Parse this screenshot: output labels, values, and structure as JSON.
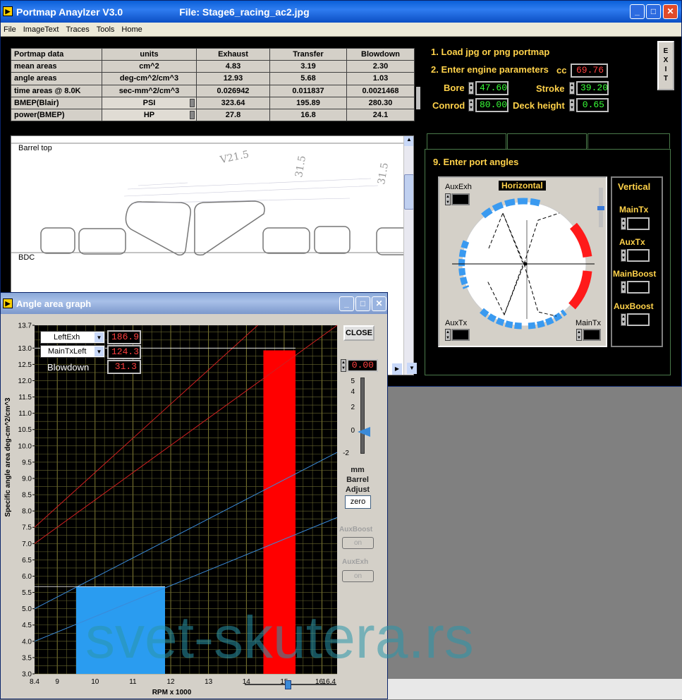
{
  "main_window": {
    "title": "Portmap Anaylzer V3.0",
    "file_label": "File: Stage6_racing_ac2.jpg"
  },
  "menu": [
    "File",
    "ImageText",
    "Traces",
    "Tools",
    "Home"
  ],
  "table": {
    "headers": [
      "Portmap data",
      "units",
      "Exhaust",
      "Transfer",
      "Blowdown"
    ],
    "rows": [
      [
        "mean areas",
        "cm^2",
        "4.83",
        "3.19",
        "2.30"
      ],
      [
        "angle areas",
        "deg-cm^2/cm^3",
        "12.93",
        "5.68",
        "1.03"
      ],
      [
        "time areas @ 8.0K",
        "sec-mm^2/cm^3",
        "0.026942",
        "0.011837",
        "0.0021468"
      ],
      [
        "BMEP(Blair)",
        "PSI",
        "323.64",
        "195.89",
        "280.30"
      ],
      [
        "power(BMEP)",
        "HP",
        "27.8",
        "16.8",
        "24.1"
      ]
    ]
  },
  "steps": {
    "load": "1. Load jpg or png portmap",
    "engine": "2. Enter engine parameters",
    "ports": "9. Enter port angles"
  },
  "engine": {
    "cc_label": "cc",
    "cc": "69.76",
    "bore_label": "Bore",
    "bore": "47.60",
    "stroke_label": "Stroke",
    "stroke": "39.20",
    "conrod_label": "Conrod",
    "conrod": "80.00",
    "deck_label": "Deck height",
    "deck": "0.65"
  },
  "exit_label": "EXIT",
  "image_view": {
    "top_label": "Barrel top",
    "bdc_label": "BDC",
    "handwriting": [
      "V21.5",
      "31.5",
      "31.5"
    ]
  },
  "port_panel": {
    "horizontal_label": "Horizontal",
    "vertical_label": "Vertical",
    "aux_exh": "AuxExh",
    "aux_tx": "AuxTx",
    "main_tx": "MainTx",
    "vertical_items": [
      "MainTx",
      "AuxTx",
      "MainBoost",
      "AuxBoost"
    ]
  },
  "angle_graph": {
    "title": "Angle area graph",
    "close_label": "CLOSE",
    "selectors": [
      {
        "label": "LeftExh",
        "value": "186.9"
      },
      {
        "label": "MainTxLeft",
        "value": "124.3"
      }
    ],
    "blowdown_label": "Blowdown",
    "blowdown_value": "31.3",
    "barrel_value": "0.00",
    "slider_ticks": [
      "5",
      "4",
      "2",
      "0",
      "-2"
    ],
    "barrel_caption": [
      "mm",
      "Barrel",
      "Adjust"
    ],
    "zero_label": "zero",
    "aux_boost_label": "AuxBoost",
    "aux_exh_label": "AuxExh",
    "on_label": "on",
    "watermark": "svet-skutera.rs"
  },
  "chart_data": {
    "type": "bar",
    "xlabel": "RPM x 1000",
    "ylabel": "Specific angle area  deg-cm^2/cm^3",
    "xlim": [
      8.4,
      16.4
    ],
    "ylim": [
      3.0,
      13.7
    ],
    "xticks": [
      "8.4",
      "9",
      "10",
      "11",
      "12",
      "13",
      "14",
      "15",
      "16",
      "16.4"
    ],
    "yticks": [
      "3.0",
      "3.5",
      "4.0",
      "4.5",
      "5.0",
      "5.5",
      "6.0",
      "6.5",
      "7.0",
      "7.5",
      "8.0",
      "8.5",
      "9.0",
      "9.5",
      "10.0",
      "10.5",
      "11.0",
      "11.5",
      "12.0",
      "12.5",
      "13.0",
      "13.7"
    ],
    "grid": true,
    "bars": [
      {
        "name": "transfer",
        "x0": 9.5,
        "x1": 11.85,
        "value": 5.68,
        "color": "#2a9cf0"
      },
      {
        "name": "exhaust",
        "x0": 14.45,
        "x1": 15.3,
        "value": 12.93,
        "color": "#ff0000"
      }
    ],
    "lines": [
      {
        "color": "#d02020",
        "points": [
          [
            8.4,
            7.5
          ],
          [
            14.3,
            13.7
          ]
        ]
      },
      {
        "color": "#d02020",
        "points": [
          [
            8.4,
            7.0
          ],
          [
            16.4,
            13.7
          ]
        ]
      },
      {
        "color": "#3a8ad8",
        "points": [
          [
            8.4,
            5.0
          ],
          [
            16.4,
            9.8
          ]
        ]
      },
      {
        "color": "#3a8ad8",
        "points": [
          [
            8.4,
            4.0
          ],
          [
            16.4,
            7.8
          ]
        ]
      }
    ]
  }
}
